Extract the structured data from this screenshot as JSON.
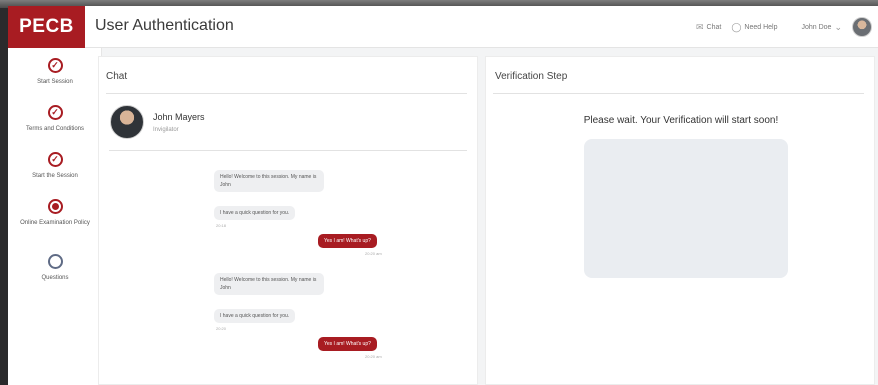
{
  "header": {
    "logo": "PECB",
    "title": "User Authentication",
    "chat_label": "Chat",
    "help_label": "Need Help",
    "user_name": "John Doe"
  },
  "sidebar": {
    "steps": [
      {
        "label": "Start Session",
        "status": "done"
      },
      {
        "label": "Terms and Conditions",
        "status": "done"
      },
      {
        "label": "Start the Session",
        "status": "done"
      },
      {
        "label": "Online Examination Policy",
        "status": "current"
      },
      {
        "label": "Questions",
        "status": "pending"
      }
    ]
  },
  "chat": {
    "title": "Chat",
    "invigilator": {
      "name": "John Mayers",
      "role": "Invigilator"
    },
    "messages": [
      {
        "from": "in",
        "text": "Hello! Welcome to this session. My name is John"
      },
      {
        "from": "in",
        "text": "I have a quick question for you.",
        "time": "20:18"
      },
      {
        "from": "out",
        "text": "Yes I am! What's up?",
        "time": "20:20 am"
      },
      {
        "from": "in",
        "text": "Hello! Welcome to this session. My name is John"
      },
      {
        "from": "in",
        "text": "I have a quick question for you.",
        "time": "20:20"
      },
      {
        "from": "out",
        "text": "Yes I am! What's up?",
        "time": "20:20 am"
      }
    ]
  },
  "verification": {
    "title": "Verification Step",
    "message": "Please wait. Your Verification will start soon!"
  },
  "colors": {
    "brand": "#a81c22",
    "pending": "#5f6b85"
  }
}
